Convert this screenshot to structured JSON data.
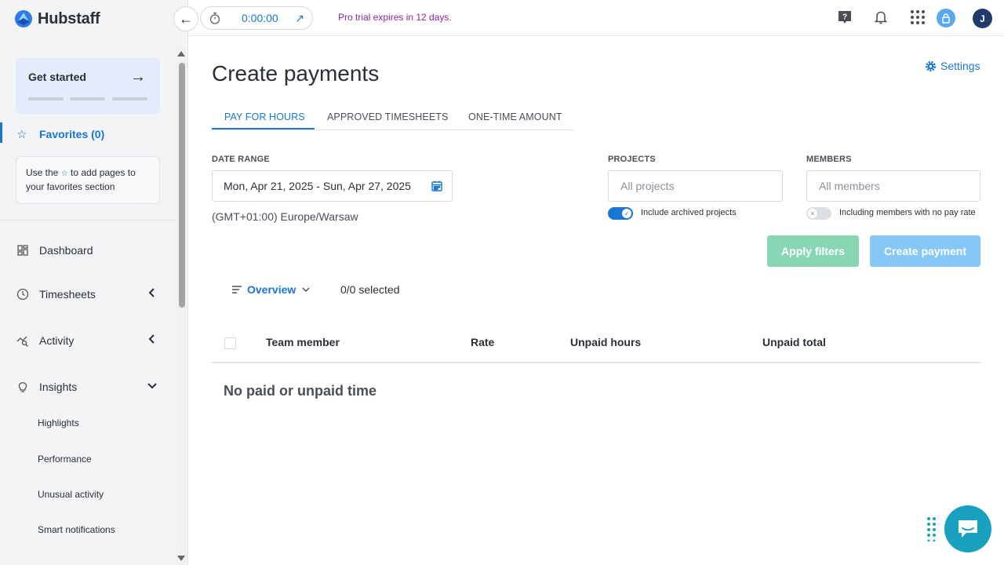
{
  "app": {
    "name": "Hubstaff",
    "brand_color": "#1976d2"
  },
  "topbar": {
    "timer": "0:00:00",
    "trial_message": "Pro trial expires in 12 days.",
    "avatar_initial": "J"
  },
  "sidebar": {
    "get_started": "Get started",
    "favorites_label": "Favorites (0)",
    "favorites_help_before": "Use the",
    "favorites_help_after": "to add pages to your favorites section",
    "nav": [
      {
        "label": "Dashboard",
        "icon": "dashboard-icon"
      },
      {
        "label": "Timesheets",
        "icon": "clock-icon",
        "expanded": false
      },
      {
        "label": "Activity",
        "icon": "activity-icon",
        "expanded": false
      },
      {
        "label": "Insights",
        "icon": "lightbulb-icon",
        "expanded": true
      }
    ],
    "insights_sub": [
      "Highlights",
      "Performance",
      "Unusual activity",
      "Smart notifications"
    ]
  },
  "main": {
    "title": "Create payments",
    "settings_label": "Settings",
    "tabs": [
      {
        "label": "PAY FOR HOURS",
        "active": true
      },
      {
        "label": "APPROVED TIMESHEETS",
        "active": false
      },
      {
        "label": "ONE-TIME AMOUNT",
        "active": false
      }
    ],
    "filters": {
      "date_range_label": "DATE RANGE",
      "date_range_value": "Mon, Apr 21, 2025 - Sun, Apr 27, 2025",
      "timezone": "(GMT+01:00) Europe/Warsaw",
      "projects_label": "PROJECTS",
      "projects_placeholder": "All projects",
      "include_archived_label": "Include archived projects",
      "include_archived_on": true,
      "members_label": "MEMBERS",
      "members_placeholder": "All members",
      "no_pay_rate_label": "Including members with no pay rate",
      "no_pay_rate_on": false
    },
    "buttons": {
      "apply": "Apply filters",
      "create": "Create payment"
    },
    "view": {
      "overview_label": "Overview",
      "selected": "0/0 selected"
    },
    "table": {
      "columns": [
        "Team member",
        "Rate",
        "Unpaid hours",
        "Unpaid total"
      ],
      "empty_message": "No paid or unpaid time"
    }
  }
}
